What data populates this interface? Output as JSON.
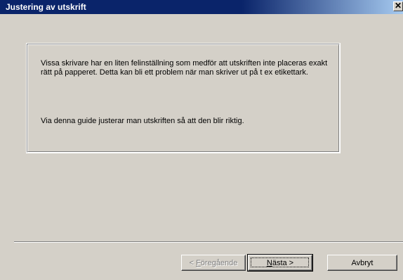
{
  "window": {
    "title": "Justering av utskrift",
    "close_glyph": "✕"
  },
  "info": {
    "paragraph1": "Vissa skrivare har en liten felinställning som medför att utskriften inte placeras exakt rätt på papperet. Detta kan bli ett problem när man skriver ut på t ex etikettark.",
    "paragraph2": "Via denna guide justerar man utskriften så att den blir riktig."
  },
  "buttons": {
    "prev": {
      "prefix": "< ",
      "accel": "F",
      "rest": "öregående",
      "enabled": false
    },
    "next": {
      "accel": "N",
      "rest": "ästa >",
      "enabled": true
    },
    "cancel": {
      "label": "Avbryt",
      "enabled": true
    }
  },
  "icons": {
    "close": "close-icon"
  },
  "colors": {
    "title_bar_start": "#0a246a",
    "title_bar_end": "#a6caf0",
    "face": "#d4d0c8",
    "disabled_text": "#808080"
  }
}
